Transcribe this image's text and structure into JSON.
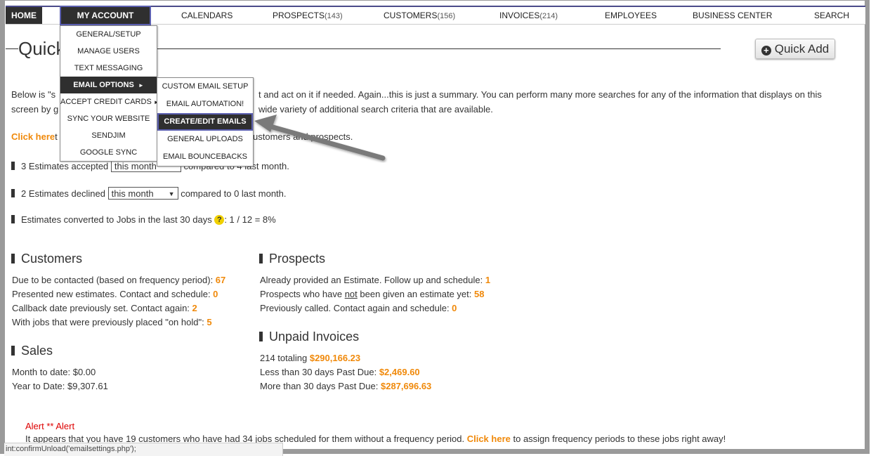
{
  "nav": {
    "home": "HOME",
    "my_account": "MY ACCOUNT",
    "calendars": "CALENDARS",
    "prospects": "PROSPECTS",
    "prospects_count": "(143)",
    "customers": "CUSTOMERS",
    "customers_count": "(156)",
    "invoices": "INVOICES",
    "invoices_count": "(214)",
    "employees": "EMPLOYEES",
    "business_center": "BUSINESS CENTER",
    "search": "SEARCH"
  },
  "my_account_menu": {
    "items": [
      "GENERAL/SETUP",
      "MANAGE USERS",
      "TEXT MESSAGING",
      "EMAIL OPTIONS",
      "ACCEPT CREDIT CARDS",
      "SYNC YOUR WEBSITE",
      "SENDJIM",
      "GOOGLE SYNC"
    ]
  },
  "email_options_menu": {
    "items": [
      "CUSTOM EMAIL SETUP",
      "EMAIL AUTOMATION!",
      "CREATE/EDIT EMAILS",
      "GENERAL UPLOADS",
      "EMAIL BOUNCEBACKS"
    ]
  },
  "page": {
    "title": "Quick",
    "quick_add": "Quick Add",
    "intro_line1_a": "Below is \"s",
    "intro_line1_b": "t and act on it if needed. Again...this is just a summary. You can perform many more searches for any of the information that displays on this",
    "intro_line2_a": "screen by g",
    "intro_line2_b": "wide variety of additional search criteria that are available.",
    "click_here": "Click here",
    "click_here_rest_a": "t",
    "click_here_rest_b": "ustomers and prospects.",
    "est_accepted": "3 Estimates accepted",
    "est_accepted_select": "this month",
    "est_accepted_compare": "compared to 4 last month.",
    "est_declined": "2 Estimates declined",
    "est_declined_select": "this month",
    "est_declined_compare": "compared to 0 last month.",
    "est_converted": "Estimates converted to Jobs in the last 30 days",
    "est_converted_value": ": 1 / 12 = 8%"
  },
  "customers": {
    "heading": "Customers",
    "due_label": "Due to be contacted (based on frequency period): ",
    "due_value": "67",
    "presented_label": "Presented new estimates. Contact and schedule: ",
    "presented_value": "0",
    "callback_label": "Callback date previously set. Contact again: ",
    "callback_value": "2",
    "onhold_label": "With jobs that were previously placed \"on hold\": ",
    "onhold_value": "5"
  },
  "prospects": {
    "heading": "Prospects",
    "estimate_label": "Already provided an Estimate. Follow up and schedule: ",
    "estimate_value": "1",
    "not_given_a": "Prospects who have ",
    "not_given_not": "not",
    "not_given_b": " been given an estimate yet: ",
    "not_given_value": "58",
    "called_label": "Previously called. Contact again and schedule: ",
    "called_value": "0"
  },
  "sales": {
    "heading": "Sales",
    "month": "Month to date: $0.00",
    "year": "Year to Date: $9,307.61"
  },
  "unpaid": {
    "heading": "Unpaid Invoices",
    "total_label": "214 totaling ",
    "total_value": "$290,166.23",
    "lt30_label": "Less than 30 days Past Due: ",
    "lt30_value": "$2,469.60",
    "gt30_label": "More than 30 days Past Due: ",
    "gt30_value": "$287,696.63"
  },
  "alert": {
    "title": "Alert ** Alert",
    "text_a": "It appears that you have 19 customers who have had 34 jobs scheduled for them without a frequency period. ",
    "click_here": "Click here",
    "text_b": " to assign frequency periods to these jobs right away!"
  },
  "status_bar": "int:confirmUnload('emailsettings.php');"
}
